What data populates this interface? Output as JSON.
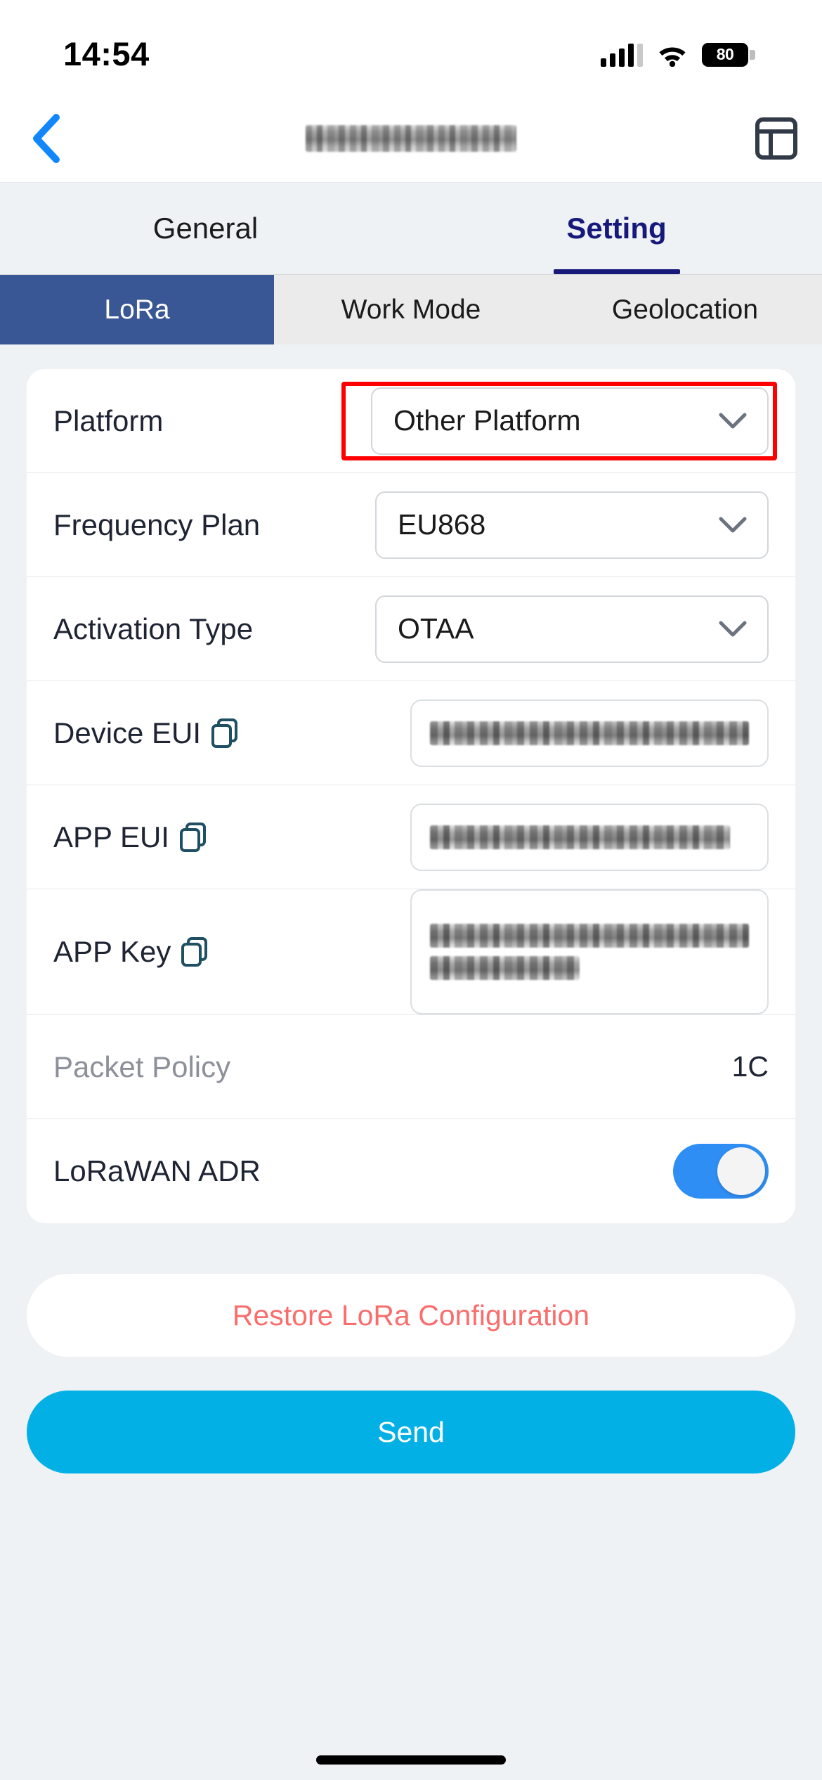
{
  "status_bar": {
    "time": "14:54",
    "battery_level": "80",
    "signal_icon": "cellular-signal-icon",
    "wifi_icon": "wifi-icon",
    "battery_icon": "battery-icon"
  },
  "nav_bar": {
    "back_icon": "back-chevron-icon",
    "title": "",
    "title_redacted": true,
    "panel_icon": "layout-panel-icon"
  },
  "tabs": [
    {
      "label": "General",
      "active": false
    },
    {
      "label": "Setting",
      "active": true
    }
  ],
  "segments": [
    {
      "label": "LoRa",
      "selected": true
    },
    {
      "label": "Work Mode",
      "selected": false
    },
    {
      "label": "Geolocation",
      "selected": false
    }
  ],
  "settings": {
    "platform": {
      "label": "Platform",
      "value": "Other Platform",
      "chevron_icon": "chevron-down-icon",
      "highlighted": true,
      "highlight_color": "#ff0000"
    },
    "frequency_plan": {
      "label": "Frequency Plan",
      "value": "EU868",
      "chevron_icon": "chevron-down-icon"
    },
    "activation_type": {
      "label": "Activation Type",
      "value": "OTAA",
      "chevron_icon": "chevron-down-icon"
    },
    "device_eui": {
      "label": "Device EUI",
      "copy_icon": "copy-icon",
      "value": "",
      "value_redacted": true
    },
    "app_eui": {
      "label": "APP EUI",
      "copy_icon": "copy-icon",
      "value": "",
      "value_redacted": true
    },
    "app_key": {
      "label": "APP Key",
      "copy_icon": "copy-icon",
      "value": "",
      "value_redacted": true
    },
    "packet_policy": {
      "label": "Packet Policy",
      "value": "1C",
      "disabled": true
    },
    "lorawan_adr": {
      "label": "LoRaWAN ADR",
      "toggle_on": true,
      "toggle_color": "#2f8ef4"
    }
  },
  "actions": {
    "restore_label": "Restore LoRa Configuration",
    "restore_color": "#fa6d6d",
    "send_label": "Send",
    "send_color": "#03b0e6"
  },
  "colors": {
    "page_background": "#eff2f5",
    "card_background": "#ffffff",
    "active_tab": "#16197a",
    "selected_segment": "#3a5795",
    "text_primary": "#1e2433",
    "text_muted": "#8b9099"
  }
}
